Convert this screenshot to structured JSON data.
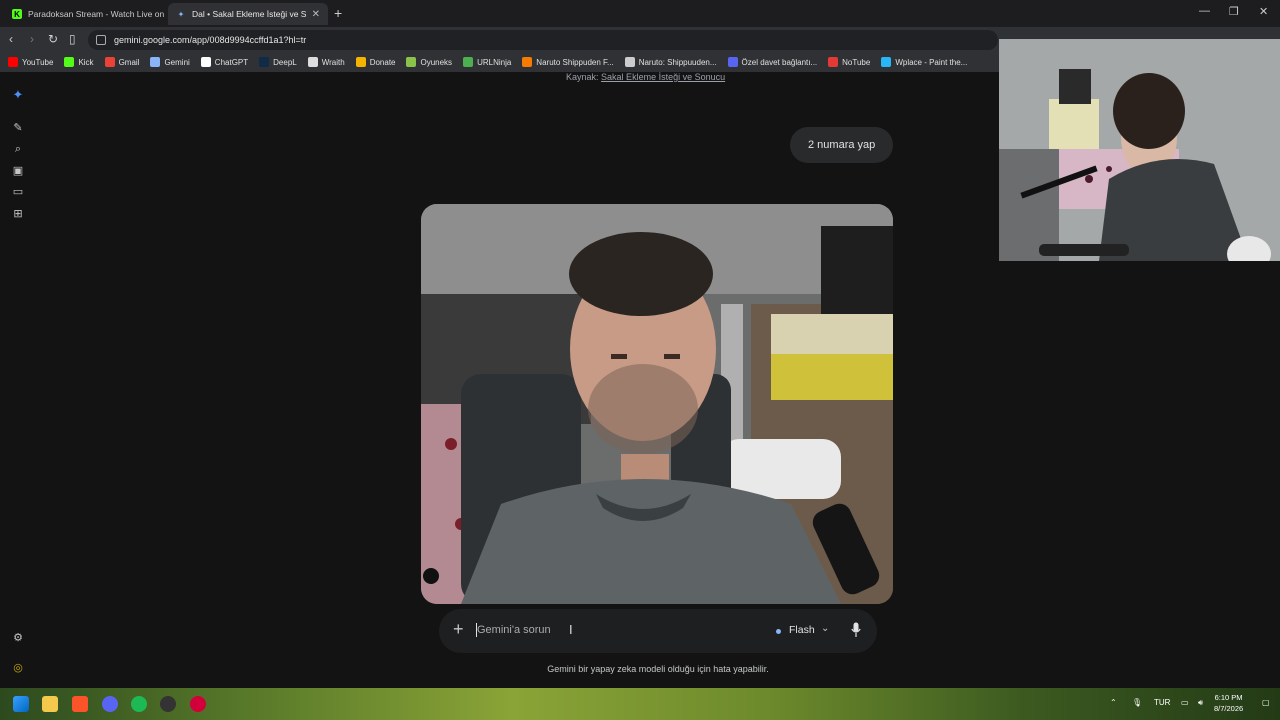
{
  "browser": {
    "tabs": [
      {
        "label": "Paradoksan Stream - Watch Live on K",
        "favicon": "kick-icon",
        "active": false
      },
      {
        "label": "Dal • Sakal Ekleme İsteği ve Sonu",
        "favicon": "gemini-icon",
        "active": true
      }
    ],
    "url": "gemini.google.com/app/008d9994ccffd1a1?hl=tr",
    "bookmarks": [
      {
        "label": "YouTube",
        "color": "#ff0000"
      },
      {
        "label": "Kick",
        "color": "#53fc18"
      },
      {
        "label": "Gmail",
        "color": "#ea4335"
      },
      {
        "label": "Gemini",
        "color": "#8ab4f8"
      },
      {
        "label": "ChatGPT",
        "color": "#ffffff"
      },
      {
        "label": "DeepL",
        "color": "#0f2b46"
      },
      {
        "label": "Wraith",
        "color": "#dddddd"
      },
      {
        "label": "Donate",
        "color": "#f4b400"
      },
      {
        "label": "Oyuneks",
        "color": "#8bc34a"
      },
      {
        "label": "URLNinja",
        "color": "#4caf50"
      },
      {
        "label": "Naruto Shippuden F...",
        "color": "#f57c00"
      },
      {
        "label": "Naruto: Shippuuden...",
        "color": "#cccccc"
      },
      {
        "label": "Özel davet bağlantı...",
        "color": "#5865f2"
      },
      {
        "label": "NoTube",
        "color": "#e53935"
      },
      {
        "label": "Wplace - Paint the...",
        "color": "#29b6f6"
      }
    ]
  },
  "gemini": {
    "source_prefix": "Kaynak:",
    "source_link": "Sakal Ekleme İsteği ve Sonucu",
    "user_message": "2 numara yap",
    "input_placeholder": "Gemini'a sorun",
    "model_label": "Flash",
    "disclaimer": "Gemini bir yapay zeka modeli olduğu için hata yapabilir."
  },
  "taskbar": {
    "language": "TUR",
    "time": "6:10 PM",
    "date": "8/7/2026"
  }
}
